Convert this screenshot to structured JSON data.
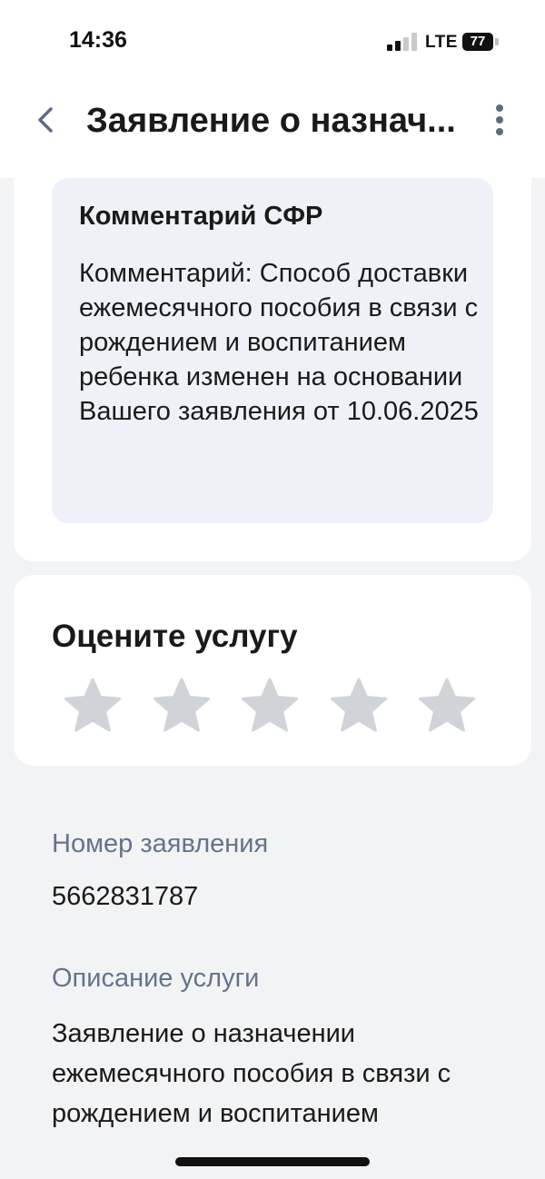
{
  "status_bar": {
    "time": "14:36",
    "network": "LTE",
    "battery": "77"
  },
  "nav": {
    "title": "Заявление о назнач...",
    "back_icon": "chevron-left-icon",
    "more_icon": "vertical-dots-icon"
  },
  "comment": {
    "title": "Комментарий СФР",
    "text": "Комментарий: Способ доставки ежемесячного пособия в связи с рождением и воспитанием ребенка изменен на основании Вашего заявления от 10.06.2025"
  },
  "rating": {
    "title": "Оцените услугу",
    "max_stars": 5,
    "selected": 0,
    "star_color": "#d0d3d8"
  },
  "details": {
    "number_label": "Номер заявления",
    "number_value": "5662831787",
    "description_label": "Описание услуги",
    "description_value": "Заявление о назначении ежемесячного пособия в связи с рождением и воспитанием"
  },
  "colors": {
    "background": "#f2f3f5",
    "card": "#ffffff",
    "comment_box": "#eef2f8",
    "label": "#66738a",
    "text": "#1a1a1a"
  }
}
